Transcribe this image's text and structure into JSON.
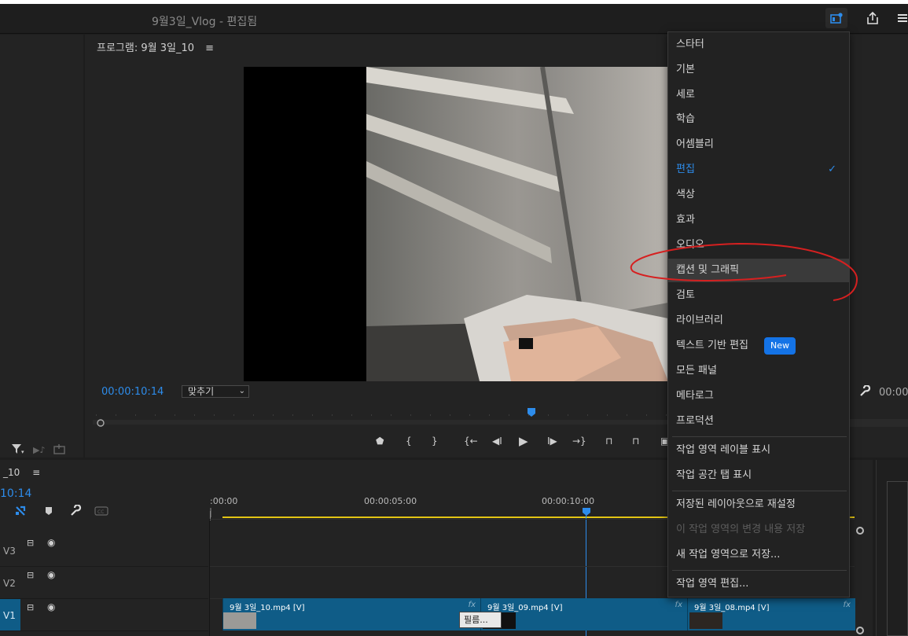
{
  "header": {
    "title": "9월3일_Vlog",
    "title_suffix": "- 편집됨"
  },
  "monitor": {
    "title": "프로그램: 9월 3일_10",
    "menu_glyph": "≡",
    "timecode": "00:00:10:14",
    "fit_value": "맞추기",
    "right_timecode": "00:00"
  },
  "timeline": {
    "sequence_name": "_10",
    "menu_glyph": "≡",
    "timecode": "10:14",
    "ruler_labels": [
      ":00:00",
      "00:00:05:00",
      "00:00:10:00"
    ],
    "tracks": [
      {
        "label": "V3"
      },
      {
        "label": "V2"
      },
      {
        "label": "V1"
      }
    ],
    "clips": [
      {
        "label": "9월 3일_10.mp4 [V]",
        "fx": "fx"
      },
      {
        "label": "9월 3일_09.mp4 [V]",
        "fx": "fx"
      },
      {
        "label": "9월 3일_08.mp4 [V]",
        "fx": "fx"
      }
    ],
    "transition_label": "필름..."
  },
  "workspace_menu": {
    "items": [
      {
        "label": "스타터"
      },
      {
        "label": "기본"
      },
      {
        "label": "세로"
      },
      {
        "label": "학습"
      },
      {
        "label": "어셈블리"
      },
      {
        "label": "편집",
        "checked": true
      },
      {
        "label": "색상"
      },
      {
        "label": "효과"
      },
      {
        "label": "오디오"
      },
      {
        "label": "캡션 및 그래픽"
      },
      {
        "label": "검토"
      },
      {
        "label": "라이브러리"
      },
      {
        "label": "텍스트 기반 편집",
        "badge": "New"
      },
      {
        "label": "모든 패널"
      },
      {
        "label": "메타로그"
      },
      {
        "label": "프로덕션"
      }
    ],
    "actions": [
      {
        "label": "작업 영역 레이블 표시"
      },
      {
        "label": "작업 공간 탭 표시"
      }
    ],
    "layout_actions": [
      {
        "label": "저장된 레이아웃으로 재설정"
      },
      {
        "label": "이 작업 영역의 변경 내용 저장",
        "disabled": true
      },
      {
        "label": "새 작업 영역으로 저장..."
      }
    ],
    "edit_action": {
      "label": "작업 영역 편집..."
    },
    "checkmark": "✓"
  },
  "colors": {
    "accent": "#2d8ceb",
    "clip": "#0f5c87",
    "annotation": "#d62020",
    "playhead": "#2d8ceb"
  }
}
